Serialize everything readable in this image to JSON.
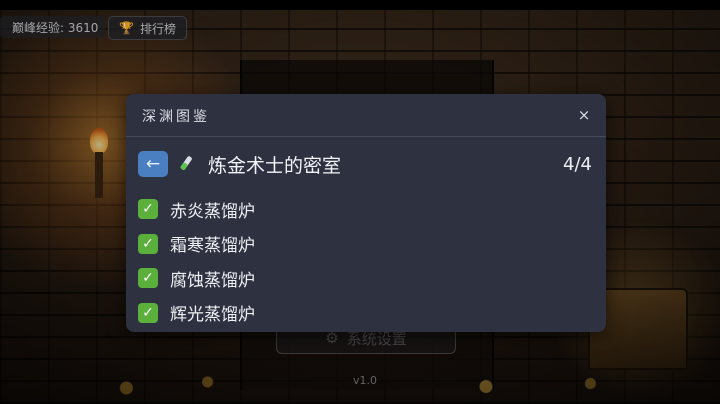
{
  "hud": {
    "experience_text": "巅峰经验: 3610",
    "leaderboard_label": "排行榜",
    "leaderboard_icon": "trophy-icon"
  },
  "background": {
    "settings_button_label": "系统设置",
    "version": "v1.0"
  },
  "modal": {
    "title": "深渊图鉴",
    "close_icon": "×",
    "back_icon": "←",
    "section_title": "炼金术士的密室",
    "progress": "4/4",
    "items": [
      {
        "label": "赤炎蒸馏炉",
        "checked": true
      },
      {
        "label": "霜寒蒸馏炉",
        "checked": true
      },
      {
        "label": "腐蚀蒸馏炉",
        "checked": true
      },
      {
        "label": "辉光蒸馏炉",
        "checked": true
      }
    ]
  },
  "colors": {
    "modal_bg": "#2e3240",
    "accent_blue": "#4a7fc1",
    "check_green": "#5bb03c"
  }
}
